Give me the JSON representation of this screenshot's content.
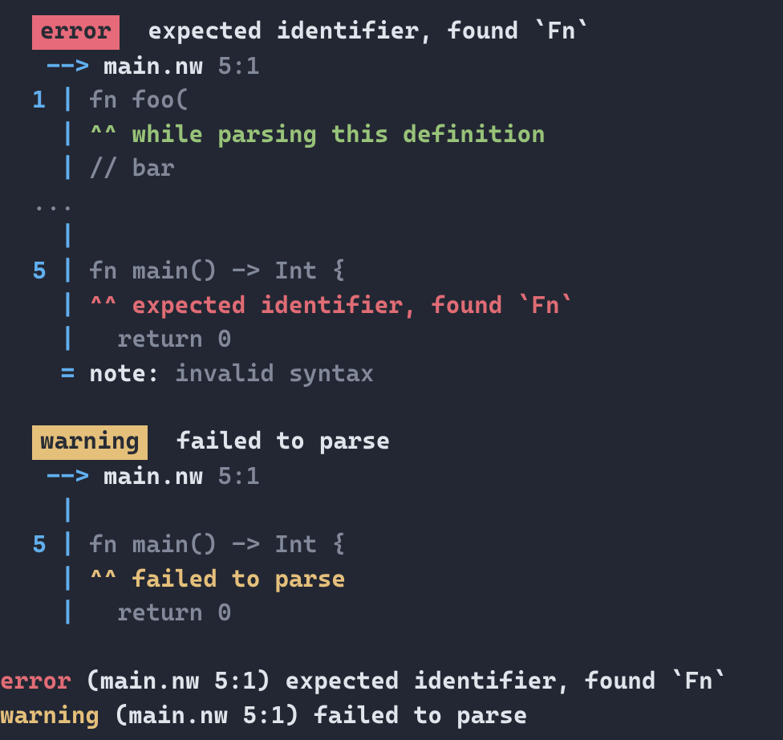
{
  "diagnostics": [
    {
      "severity_label": "error",
      "header_msg": "expected identifier, found `Fn`",
      "arrow": "-->",
      "loc_file": "main.nw",
      "loc_pos": "5:1",
      "body": {
        "l1_gutter": "1",
        "l1_code": "fn foo(",
        "l1_carets": "^^",
        "l1_label": "while parsing this definition",
        "l2_code": "// bar",
        "ellipsis": "...",
        "l5_gutter": "5",
        "l5_code": "fn main() -> Int {",
        "l5_carets": "^^",
        "l5_label": "expected identifier, found `Fn`",
        "l6_code": "  return 0",
        "note_eq": "=",
        "note_key": "note:",
        "note_msg": "invalid syntax"
      }
    },
    {
      "severity_label": "warning",
      "header_msg": "failed to parse",
      "arrow": "-->",
      "loc_file": "main.nw",
      "loc_pos": "5:1",
      "body": {
        "l5_gutter": "5",
        "l5_code": "fn main() -> Int {",
        "l5_carets": "^^",
        "l5_label": "failed to parse",
        "l6_code": "  return 0"
      }
    }
  ],
  "summary": [
    {
      "severity": "error",
      "paren": "(main.nw 5:1)",
      "msg": "expected identifier, found `Fn`"
    },
    {
      "severity": "warning",
      "paren": "(main.nw 5:1)",
      "msg": "failed to parse"
    }
  ],
  "colors": {
    "bg": "#232733",
    "error_badge": "#e76a7a",
    "warn_badge": "#e5c07b",
    "green": "#98c379",
    "red_fg": "#e06c75",
    "yellow_fg": "#e5c07b",
    "blue": "#61afef"
  }
}
